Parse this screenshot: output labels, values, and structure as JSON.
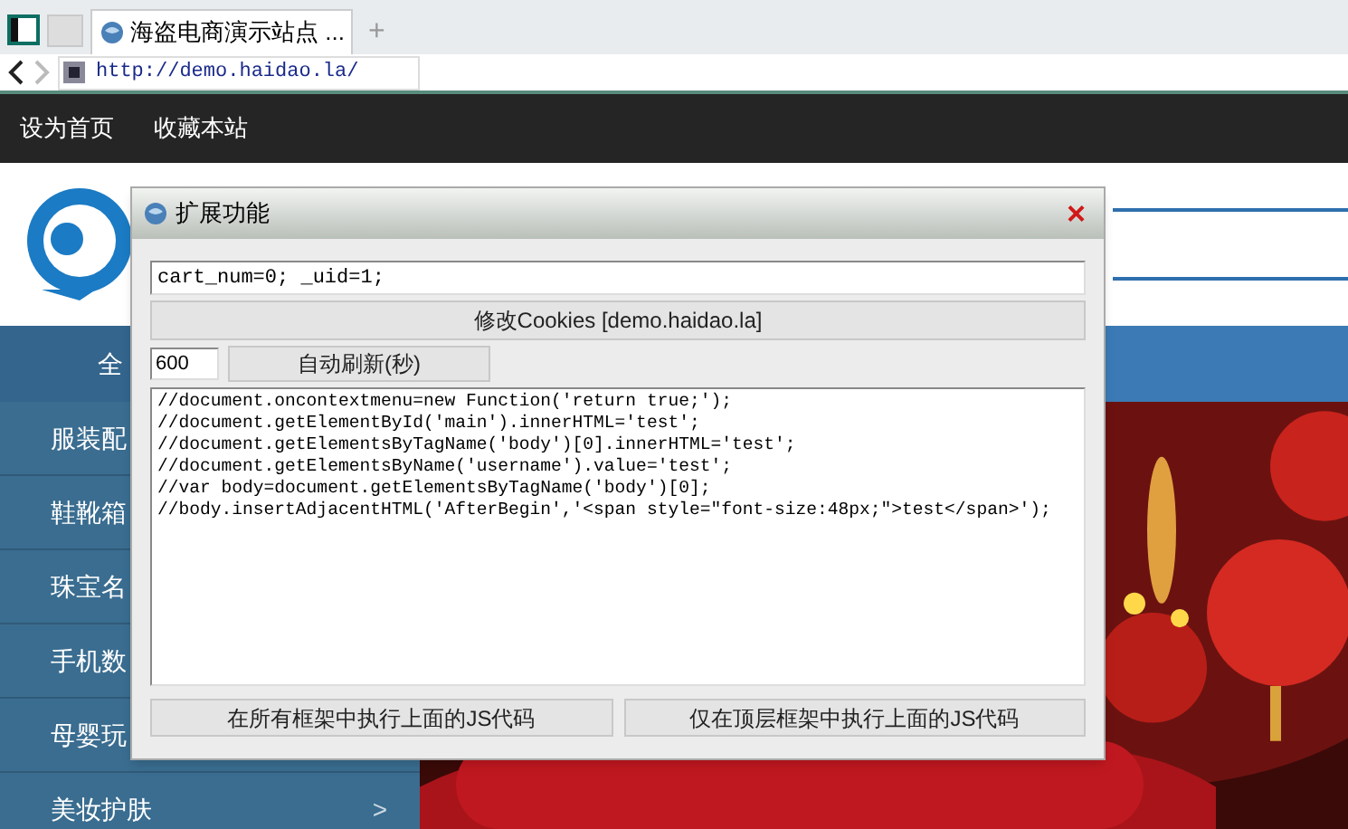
{
  "browser": {
    "tabs": [
      {
        "label": "海盗电商演示站点 ...",
        "selected": true
      }
    ],
    "new_tab": "+",
    "url": "http://demo.haidao.la/"
  },
  "topbar": {
    "links": [
      "设为首页",
      "收藏本站"
    ]
  },
  "category_bar": {
    "label": "全"
  },
  "sidebar": {
    "items": [
      {
        "label": "服装配"
      },
      {
        "label": "鞋靴箱"
      },
      {
        "label": "珠宝名"
      },
      {
        "label": "手机数"
      },
      {
        "label": "母婴玩"
      },
      {
        "label": "美妆护肤",
        "arrow": ">"
      }
    ]
  },
  "dialog": {
    "title": "扩展功能",
    "close": "×",
    "cookie_value": "cart_num=0; _uid=1;",
    "cookie_button": "修改Cookies [demo.haidao.la]",
    "refresh_value": "600",
    "refresh_button": "自动刷新(秒)",
    "code_lines": [
      "//document.oncontextmenu=new Function('return true;');",
      "//document.getElementById('main').innerHTML='test';",
      "//document.getElementsByTagName('body')[0].innerHTML='test';",
      "//document.getElementsByName('username').value='test';",
      "//var body=document.getElementsByTagName('body')[0];",
      "//body.insertAdjacentHTML('AfterBegin','<span style=\"font-size:48px;\">test</span>');"
    ],
    "buttons": [
      "在所有框架中执行上面的JS代码",
      "仅在顶层框架中执行上面的JS代码"
    ]
  }
}
